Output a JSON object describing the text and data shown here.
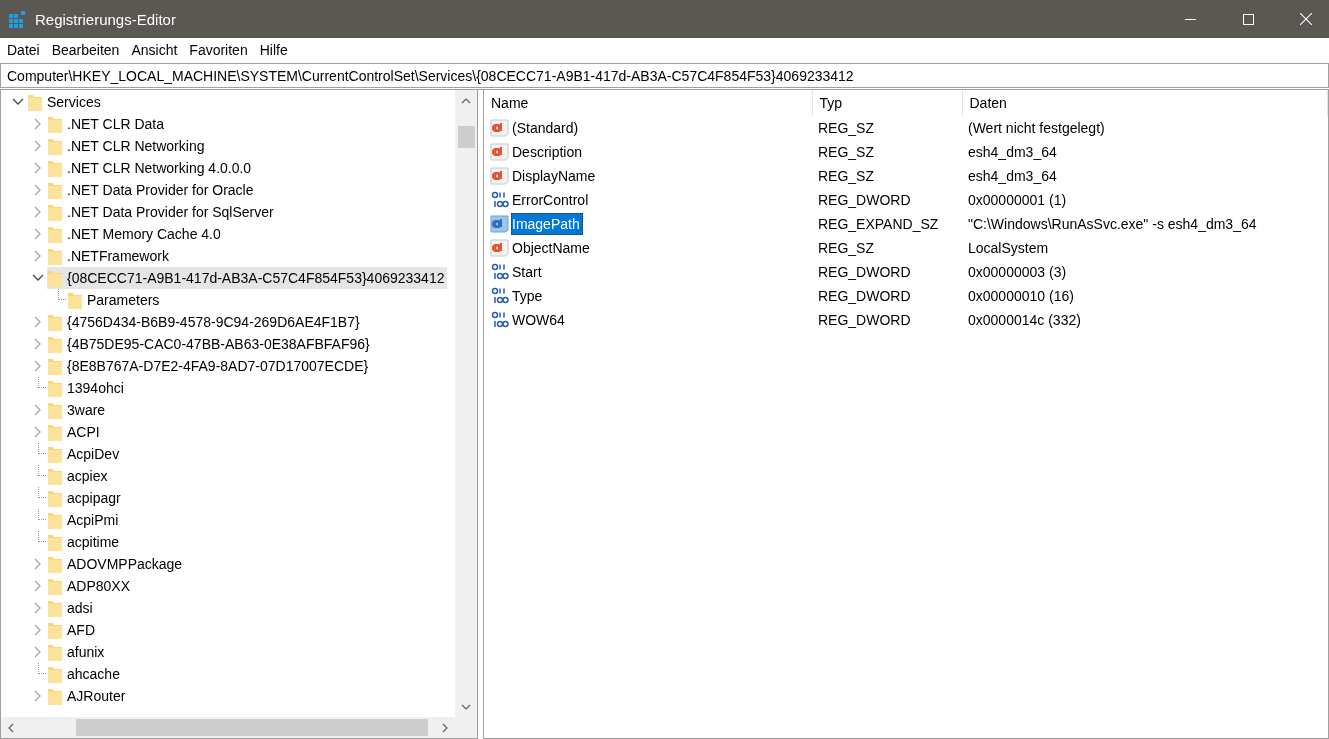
{
  "window": {
    "title": "Registrierungs-Editor"
  },
  "menu": [
    "Datei",
    "Bearbeiten",
    "Ansicht",
    "Favoriten",
    "Hilfe"
  ],
  "address": "Computer\\HKEY_LOCAL_MACHINE\\SYSTEM\\CurrentControlSet\\Services\\{08CECC71-A9B1-417d-AB3A-C57C4F854F53}4069233412",
  "tree": {
    "items": [
      {
        "label": "Services",
        "kind": "node",
        "expanded": true,
        "selected": false,
        "children": [
          {
            "label": ".NET CLR Data",
            "kind": "node",
            "expanded": false,
            "selected": false
          },
          {
            "label": ".NET CLR Networking",
            "kind": "node",
            "expanded": false,
            "selected": false
          },
          {
            "label": ".NET CLR Networking 4.0.0.0",
            "kind": "node",
            "expanded": false,
            "selected": false
          },
          {
            "label": ".NET Data Provider for Oracle",
            "kind": "node",
            "expanded": false,
            "selected": false
          },
          {
            "label": ".NET Data Provider for SqlServer",
            "kind": "node",
            "expanded": false,
            "selected": false
          },
          {
            "label": ".NET Memory Cache 4.0",
            "kind": "node",
            "expanded": false,
            "selected": false
          },
          {
            "label": ".NETFramework",
            "kind": "node",
            "expanded": false,
            "selected": false
          },
          {
            "label": "{08CECC71-A9B1-417d-AB3A-C57C4F854F53}4069233412",
            "kind": "node",
            "expanded": true,
            "selected": true,
            "children": [
              {
                "label": "Parameters",
                "kind": "leaf",
                "selected": false
              }
            ]
          },
          {
            "label": "{4756D434-B6B9-4578-9C94-269D6AE4F1B7}",
            "kind": "node",
            "expanded": false,
            "selected": false
          },
          {
            "label": "{4B75DE95-CAC0-47BB-AB63-0E38AFBFAF96}",
            "kind": "node",
            "expanded": false,
            "selected": false
          },
          {
            "label": "{8E8B767A-D7E2-4FA9-8AD7-07D17007ECDE}",
            "kind": "node",
            "expanded": false,
            "selected": false
          },
          {
            "label": "1394ohci",
            "kind": "leaf",
            "selected": false
          },
          {
            "label": "3ware",
            "kind": "node",
            "expanded": false,
            "selected": false
          },
          {
            "label": "ACPI",
            "kind": "node",
            "expanded": false,
            "selected": false
          },
          {
            "label": "AcpiDev",
            "kind": "leaf",
            "selected": false
          },
          {
            "label": "acpiex",
            "kind": "leaf",
            "selected": false
          },
          {
            "label": "acpipagr",
            "kind": "leaf",
            "selected": false
          },
          {
            "label": "AcpiPmi",
            "kind": "leaf",
            "selected": false
          },
          {
            "label": "acpitime",
            "kind": "leaf",
            "selected": false
          },
          {
            "label": "ADOVMPPackage",
            "kind": "node",
            "expanded": false,
            "selected": false
          },
          {
            "label": "ADP80XX",
            "kind": "node",
            "expanded": false,
            "selected": false
          },
          {
            "label": "adsi",
            "kind": "node",
            "expanded": false,
            "selected": false
          },
          {
            "label": "AFD",
            "kind": "node",
            "expanded": false,
            "selected": false
          },
          {
            "label": "afunix",
            "kind": "node",
            "expanded": false,
            "selected": false
          },
          {
            "label": "ahcache",
            "kind": "leaf",
            "selected": false
          },
          {
            "label": "AJRouter",
            "kind": "node",
            "expanded": false,
            "selected": false
          }
        ]
      }
    ]
  },
  "values": {
    "columns": [
      "Name",
      "Typ",
      "Daten"
    ],
    "rows": [
      {
        "kind": "string",
        "name": "(Standard)",
        "type": "REG_SZ",
        "data": "(Wert nicht festgelegt)",
        "selected": false
      },
      {
        "kind": "string",
        "name": "Description",
        "type": "REG_SZ",
        "data": "esh4_dm3_64",
        "selected": false
      },
      {
        "kind": "string",
        "name": "DisplayName",
        "type": "REG_SZ",
        "data": "esh4_dm3_64",
        "selected": false
      },
      {
        "kind": "binary",
        "name": "ErrorControl",
        "type": "REG_DWORD",
        "data": "0x00000001 (1)",
        "selected": false
      },
      {
        "kind": "string",
        "name": "ImagePath",
        "type": "REG_EXPAND_SZ",
        "data": "\"C:\\Windows\\RunAsSvc.exe\" -s esh4_dm3_64",
        "selected": true
      },
      {
        "kind": "string",
        "name": "ObjectName",
        "type": "REG_SZ",
        "data": "LocalSystem",
        "selected": false
      },
      {
        "kind": "binary",
        "name": "Start",
        "type": "REG_DWORD",
        "data": "0x00000003 (3)",
        "selected": false
      },
      {
        "kind": "binary",
        "name": "Type",
        "type": "REG_DWORD",
        "data": "0x00000010 (16)",
        "selected": false
      },
      {
        "kind": "binary",
        "name": "WOW64",
        "type": "REG_DWORD",
        "data": "0x0000014c (332)",
        "selected": false
      }
    ]
  }
}
